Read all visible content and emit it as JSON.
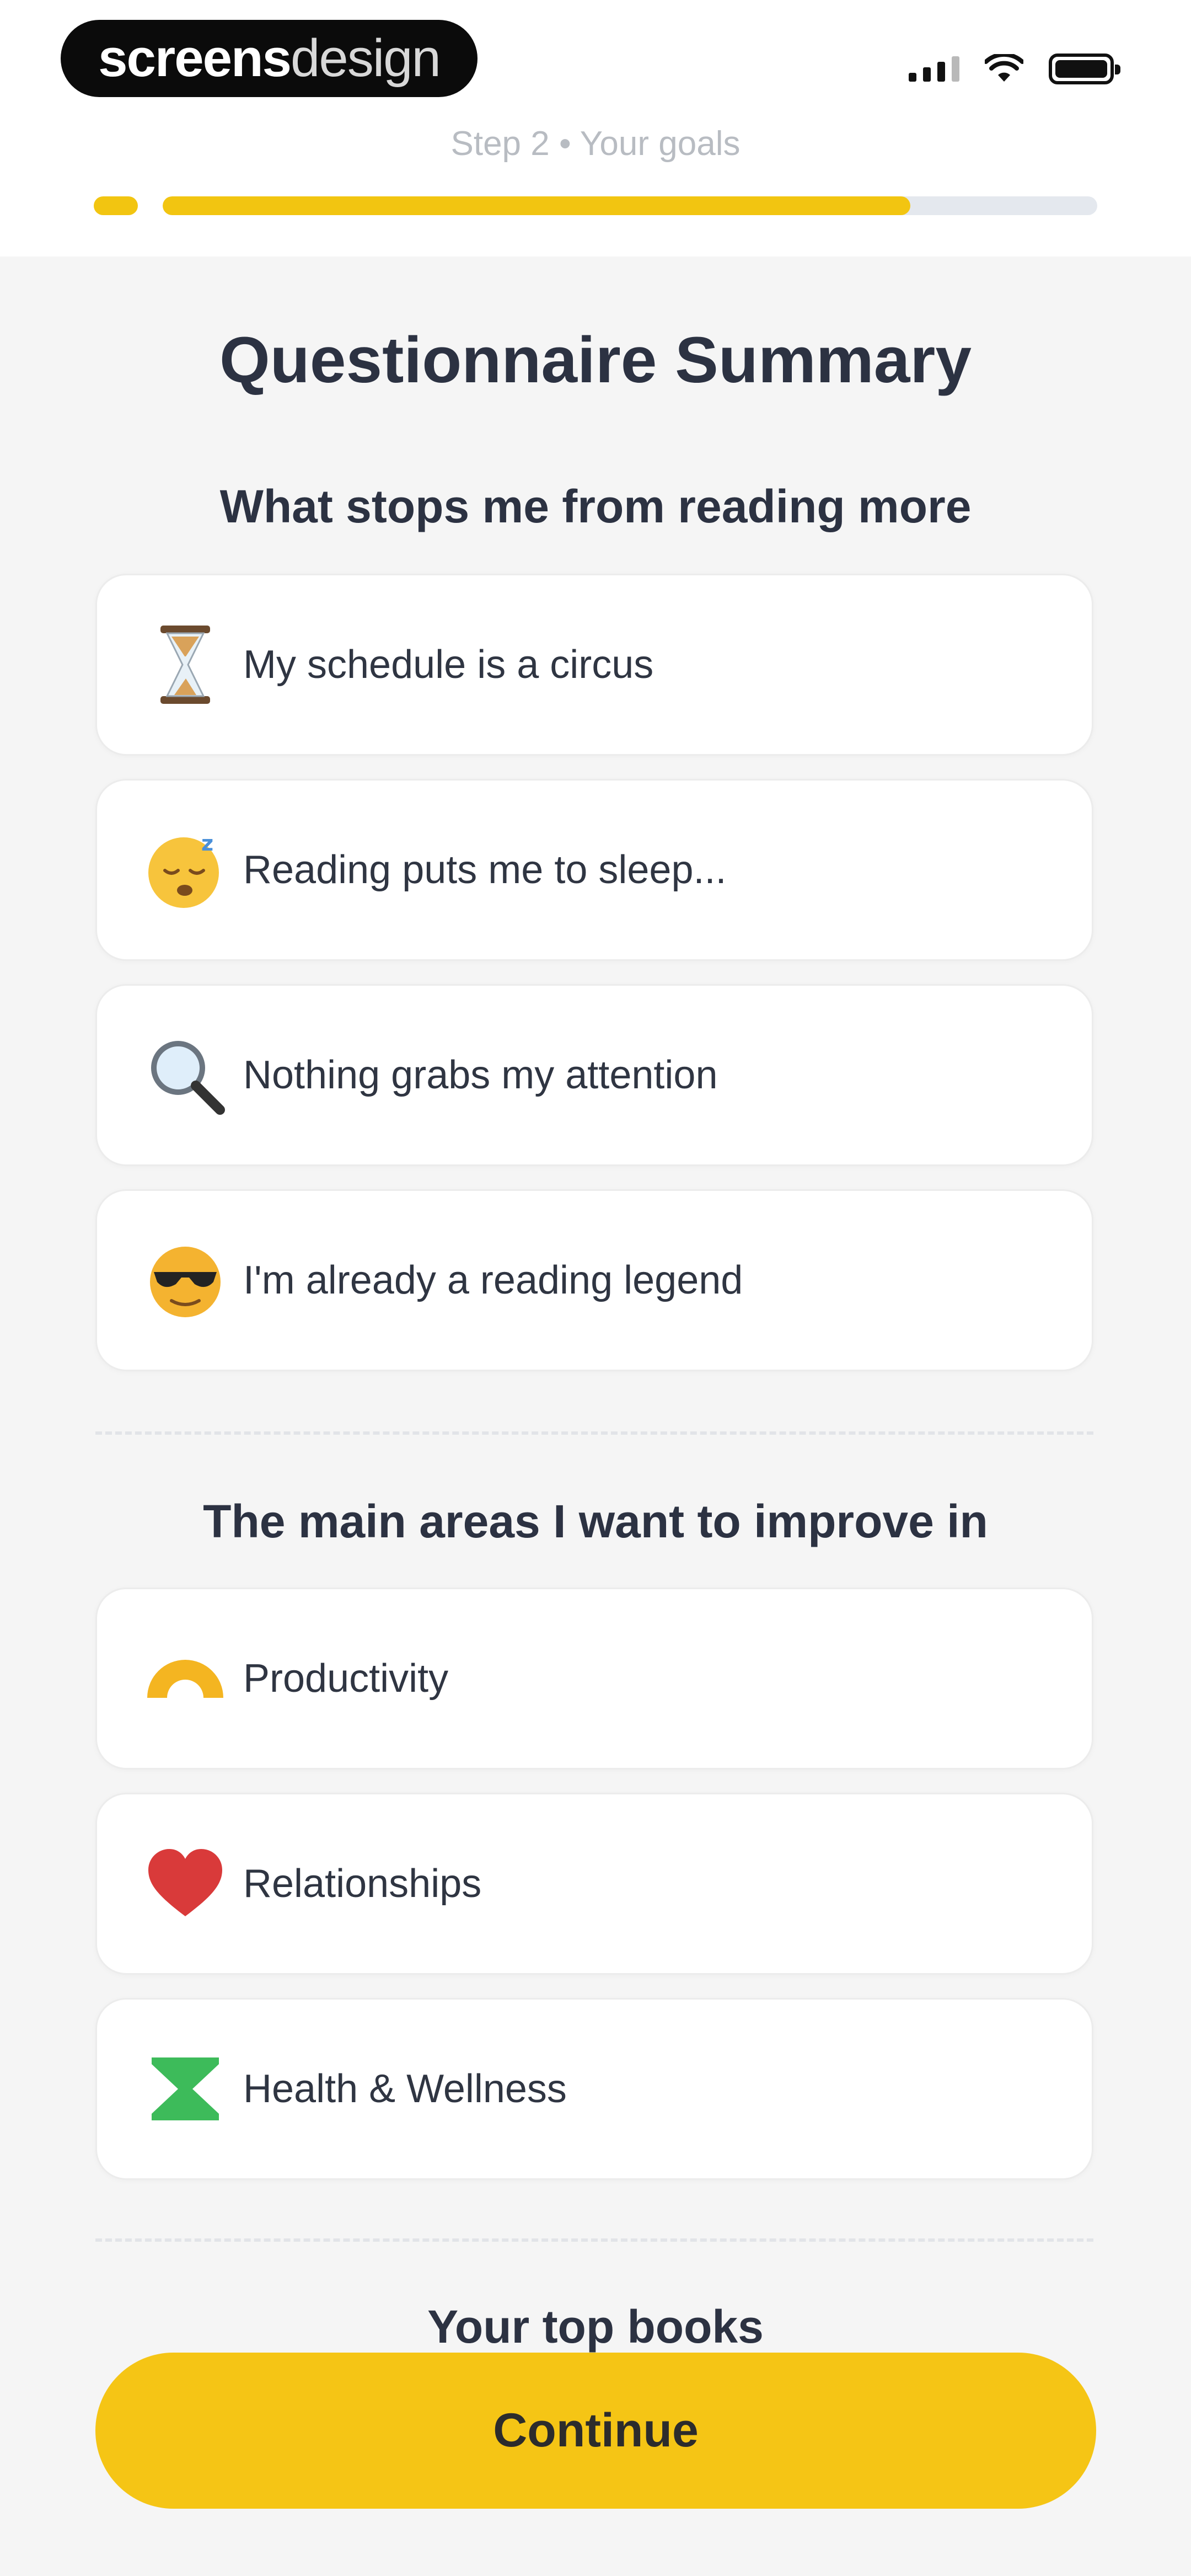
{
  "brand": {
    "bold": "screens",
    "light": "design"
  },
  "header": {
    "step_label": "Step 2 • Your goals",
    "progress": 0.8
  },
  "title": "Questionnaire Summary",
  "sections": [
    {
      "title": "What stops me from reading more",
      "items": [
        {
          "label": "My schedule is a circus",
          "icon": "hourglass-icon"
        },
        {
          "label": "Reading puts me to sleep...",
          "icon": "sleepy-face-icon"
        },
        {
          "label": "Nothing grabs my attention",
          "icon": "magnifier-icon"
        },
        {
          "label": "I'm already a reading legend",
          "icon": "sunglasses-face-icon"
        }
      ]
    },
    {
      "title": "The main areas I want to improve in",
      "items": [
        {
          "label": "Productivity",
          "icon": "productivity-arc-icon"
        },
        {
          "label": "Relationships",
          "icon": "heart-icon"
        },
        {
          "label": "Health & Wellness",
          "icon": "hourglass-shape-icon"
        }
      ]
    },
    {
      "title": "Your top books",
      "items": []
    }
  ],
  "continue_label": "Continue",
  "colors": {
    "accent": "#f5c515",
    "progress_track": "#e4e8ee",
    "heart": "#d93a3a",
    "health": "#3dbb5a",
    "productivity": "#f4b521"
  }
}
